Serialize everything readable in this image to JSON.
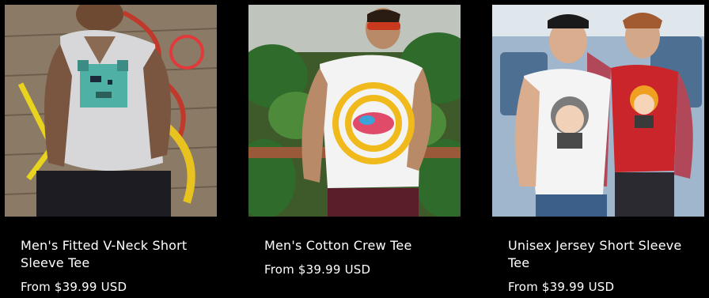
{
  "products": [
    {
      "title": "Men's Fitted V-Neck Short Sleeve Tee",
      "price": "From $39.99 USD",
      "image": "man-in-grey-vneck-tee-with-pixel-bear"
    },
    {
      "title": "Men's Cotton Crew Tee",
      "price": "From $39.99 USD",
      "image": "man-in-white-crew-tee-with-yellow-rings-graphic"
    },
    {
      "title": "Unisex Jersey Short Sleeve Tee",
      "price": "From $39.99 USD",
      "image": "couple-in-jersey-tees-with-cartoon-graphics"
    }
  ],
  "colors": {
    "background": "#000000",
    "text": "#ffffff"
  }
}
